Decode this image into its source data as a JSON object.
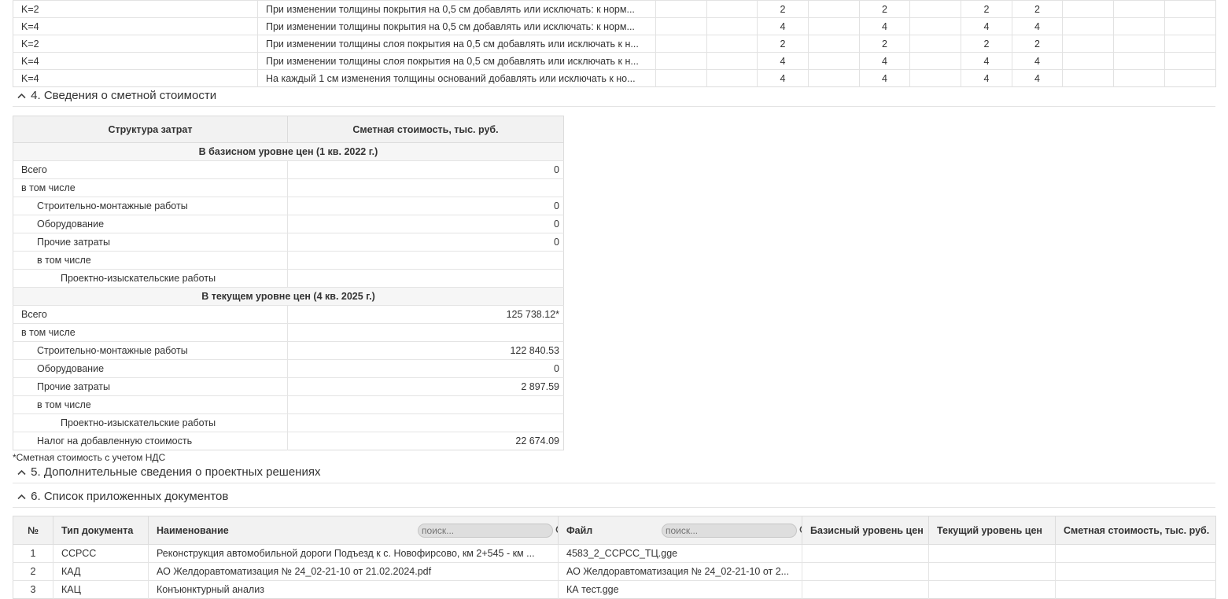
{
  "top_rows": [
    {
      "k": "K=2",
      "desc": "При изменении толщины покрытия на 0,5 см добавлять или исключать: к норм...",
      "vals": [
        "",
        "",
        "2",
        "",
        "2",
        "",
        "2",
        "2",
        "",
        "",
        ""
      ]
    },
    {
      "k": "K=4",
      "desc": "При изменении толщины покрытия на 0,5 см добавлять или исключать: к норм...",
      "vals": [
        "",
        "",
        "4",
        "",
        "4",
        "",
        "4",
        "4",
        "",
        "",
        ""
      ]
    },
    {
      "k": "K=2",
      "desc": "При изменении толщины слоя покрытия на 0,5 см добавлять или исключать к н...",
      "vals": [
        "",
        "",
        "2",
        "",
        "2",
        "",
        "2",
        "2",
        "",
        "",
        ""
      ]
    },
    {
      "k": "K=4",
      "desc": "При изменении толщины слоя покрытия на 0,5 см добавлять или исключать к н...",
      "vals": [
        "",
        "",
        "4",
        "",
        "4",
        "",
        "4",
        "4",
        "",
        "",
        ""
      ]
    },
    {
      "k": "K=4",
      "desc": "На каждый 1 см изменения толщины оснований добавлять или исключать к но...",
      "vals": [
        "",
        "",
        "4",
        "",
        "4",
        "",
        "4",
        "4",
        "",
        "",
        ""
      ]
    }
  ],
  "sections": {
    "s4": "4. Сведения о сметной стоимости",
    "s5": "5. Дополнительные сведения о проектных решениях",
    "s6": "6. Список приложенных документов"
  },
  "cost_table": {
    "headers": {
      "structure": "Структура затрат",
      "cost": "Сметная стоимость, тыс. руб."
    },
    "rows": [
      {
        "type": "band",
        "label": "В базисном уровне цен (1 кв. 2022 г.)"
      },
      {
        "level": 0,
        "label": "Всего",
        "value": "0"
      },
      {
        "level": 0,
        "label": "в том числе",
        "value": ""
      },
      {
        "level": 1,
        "label": "Строительно-монтажные работы",
        "value": "0"
      },
      {
        "level": 1,
        "label": "Оборудование",
        "value": "0"
      },
      {
        "level": 1,
        "label": "Прочие затраты",
        "value": "0"
      },
      {
        "level": 1,
        "label": "в том числе",
        "value": ""
      },
      {
        "level": 2,
        "label": "Проектно-изыскательские работы",
        "value": ""
      },
      {
        "type": "band",
        "label": "В текущем уровне цен (4 кв. 2025 г.)"
      },
      {
        "level": 0,
        "label": "Всего",
        "value": "125 738.12*"
      },
      {
        "level": 0,
        "label": "в том числе",
        "value": ""
      },
      {
        "level": 1,
        "label": "Строительно-монтажные работы",
        "value": "122 840.53"
      },
      {
        "level": 1,
        "label": "Оборудование",
        "value": "0"
      },
      {
        "level": 1,
        "label": "Прочие затраты",
        "value": "2 897.59"
      },
      {
        "level": 1,
        "label": "в том числе",
        "value": ""
      },
      {
        "level": 2,
        "label": "Проектно-изыскательские работы",
        "value": ""
      },
      {
        "level": 1,
        "label": "Налог на добавленную стоимость",
        "value": "22 674.09"
      }
    ],
    "note": "*Сметная стоимость с учетом НДС"
  },
  "docs_table": {
    "headers": {
      "num": "№",
      "type": "Тип документа",
      "name": "Наименование",
      "file": "Файл",
      "base": "Базисный уровень цен",
      "current": "Текущий уровень цен",
      "cost": "Сметная стоимость, тыс. руб."
    },
    "search_placeholder": "поиск...",
    "rows": [
      {
        "num": "1",
        "type": "ССРСС",
        "name": "Реконструкция автомобильной дороги Подъезд к с. Новофирсово, км 2+545 - км ...",
        "file": "4583_2_ССРСС_ТЦ.gge",
        "base": "",
        "current": "",
        "cost": ""
      },
      {
        "num": "2",
        "type": "КАД",
        "name": "АО Желдоравтоматизация № 24_02-21-10 от 21.02.2024.pdf",
        "file": "АО Желдоравтоматизация № 24_02-21-10 от 2...",
        "base": "",
        "current": "",
        "cost": ""
      },
      {
        "num": "3",
        "type": "КАЦ",
        "name": "Конъюнктурный анализ",
        "file": "КА тест.gge",
        "base": "",
        "current": "",
        "cost": ""
      }
    ]
  }
}
